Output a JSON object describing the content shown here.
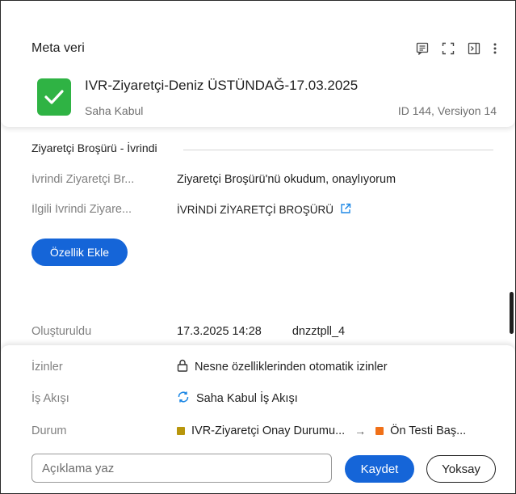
{
  "header": {
    "title": "Meta veri",
    "icons": [
      "comment-icon",
      "fullscreen-icon",
      "panel-exit-icon",
      "more-vert-icon"
    ]
  },
  "document": {
    "title": "IVR-Ziyaretçi-Deniz ÜSTÜNDAĞ-17.03.2025",
    "subtitle": "Saha Kabul",
    "id_version": "ID 144, Versiyon 14",
    "icon_color": "#2fb344"
  },
  "section": {
    "title": "Ziyaretçi Broşürü - İvrindi",
    "rows": [
      {
        "label": "İvrindi Ziyaretçi Br...",
        "value": "Ziyaretçi Broşürü'nü okudum, onaylıyorum"
      },
      {
        "label": "İlgili İvrindi Ziyare...",
        "value": "İVRİNDİ ZİYARETÇİ BROŞÜRÜ"
      }
    ],
    "add_property_label": "Özellik Ekle"
  },
  "created": {
    "label": "Oluşturuldu",
    "date": "17.3.2025 14:28",
    "user": "dnzztpll_4"
  },
  "bottom": {
    "permissions": {
      "label": "İzinler",
      "value": "Nesne özelliklerinden otomatik izinler"
    },
    "workflow": {
      "label": "İş Akışı",
      "value": "Saha Kabul İş Akışı"
    },
    "state": {
      "label": "Durum",
      "from": "IVR-Ziyaretçi Onay Durumu...",
      "from_color": "#b8960c",
      "to": "Ön Testi Baş...",
      "to_color": "#f07018"
    },
    "comment_placeholder": "Açıklama yaz",
    "save_label": "Kaydet",
    "ignore_label": "Yoksay"
  },
  "colors": {
    "accent": "#1565d8",
    "link": "#1e88e5"
  }
}
